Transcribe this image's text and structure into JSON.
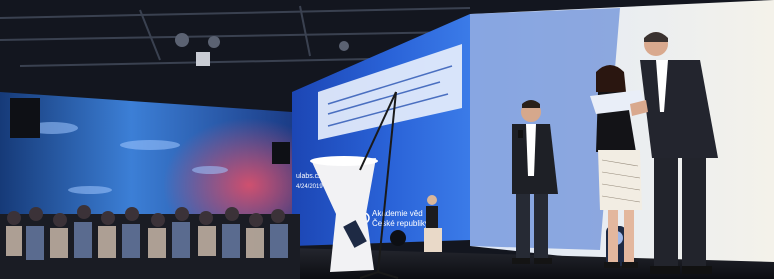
{
  "scene": {
    "description_free": true
  },
  "screen": {
    "brand_line_1": "Akademie věd",
    "brand_line_2": "České republiky",
    "side_fragment": "ulabs.cz",
    "side_fragment_2": "4/24/2019"
  },
  "colors": {
    "ceiling": "#161a26",
    "left_wall_glow": "#3c7fd6",
    "left_wall_red": "#c0405a",
    "projection_blue": "#1e4fc8",
    "projection_light": "#dce7fb",
    "floor": "#101218",
    "podium": "#f2f2f4"
  }
}
